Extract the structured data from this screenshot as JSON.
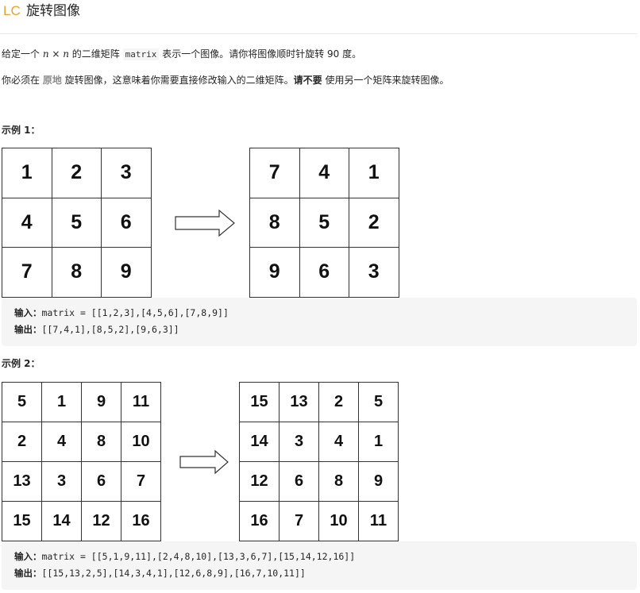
{
  "header": {
    "logo": "LC",
    "title": "旋转图像"
  },
  "description": {
    "p1_prefix": "给定一个 ",
    "p1_n1": "n",
    "p1_times": " × ",
    "p1_n2": "n",
    "p1_mid": " 的二维矩阵 ",
    "p1_code": "matrix",
    "p1_suffix": " 表示一个图像。请你将图像顺时针旋转 90 度。",
    "p2_prefix": "你必须在 ",
    "p2_link": "原地",
    "p2_mid": " 旋转图像，这意味着你需要直接修改输入的二维矩阵。",
    "p2_bold": "请不要",
    "p2_suffix": " 使用另一个矩阵来旋转图像。"
  },
  "example1": {
    "title": "示例 1：",
    "input_grid": [
      "1",
      "2",
      "3",
      "4",
      "5",
      "6",
      "7",
      "8",
      "9"
    ],
    "output_grid": [
      "7",
      "4",
      "1",
      "8",
      "5",
      "2",
      "9",
      "6",
      "3"
    ],
    "input_label": "输入：",
    "input_value": "matrix = [[1,2,3],[4,5,6],[7,8,9]]",
    "output_label": "输出：",
    "output_value": "[[7,4,1],[8,5,2],[9,6,3]]"
  },
  "example2": {
    "title": "示例 2：",
    "input_grid": [
      "5",
      "1",
      "9",
      "11",
      "2",
      "4",
      "8",
      "10",
      "13",
      "3",
      "6",
      "7",
      "15",
      "14",
      "12",
      "16"
    ],
    "output_grid": [
      "15",
      "13",
      "2",
      "5",
      "14",
      "3",
      "4",
      "1",
      "12",
      "6",
      "8",
      "9",
      "16",
      "7",
      "10",
      "11"
    ],
    "input_label": "输入：",
    "input_value": "matrix = [[5,1,9,11],[2,4,8,10],[13,3,6,7],[15,14,12,16]]",
    "output_label": "输出：",
    "output_value": "[[15,13,2,5],[14,3,4,1],[12,6,8,9],[16,7,10,11]]"
  },
  "icons": {
    "arrow": "right-arrow-icon"
  }
}
